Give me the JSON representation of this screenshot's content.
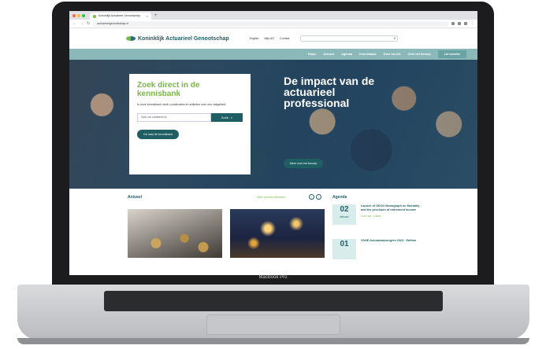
{
  "device": {
    "brand_label": "MacBook Pro"
  },
  "browser": {
    "tab_title": "Koninklijk Actuarieel Genootschap",
    "tab_close": "×",
    "new_tab": "+",
    "url": "actuarieelgenootschap.nl",
    "traffic_lights": [
      "#ff5f57",
      "#febc2e",
      "#28c840"
    ]
  },
  "site": {
    "logo_text": "Koninklijk Actuarieel Genootschap",
    "top_links": [
      "English",
      "Mijn AG",
      "Contact"
    ],
    "search_icon": "search-icon",
    "nav": [
      "Home",
      "Actueel",
      "Agenda",
      "Kennisbank",
      "Over het AG",
      "Over het beroep"
    ],
    "nav_cta": "Lid worden",
    "colors": {
      "primary": "#1f5f63",
      "accent": "#7ab648",
      "nav": "#8bb9b9"
    }
  },
  "hero": {
    "kb_title": "Zoek direct in de kennisbank",
    "kb_sub": "In onze kennisbank vindt u publicaties en artikelen over ons vakgebied.",
    "kb_placeholder": "Voer uw zoekterm in",
    "kb_button": "Zoek",
    "kb_link": "Ga naar de kennisbank",
    "title": "De impact van de actuarieel professional",
    "button": "Meer over het beroep"
  },
  "content": {
    "actueel_label": "Actueel",
    "more_label": "Meer actuele berichten",
    "agenda_label": "Agenda",
    "agenda": [
      {
        "day": "02",
        "month": "februari",
        "title": "Launch of OECD Monograph on Mortality and the provision of retirement income",
        "meta": "14:00 uur - Online"
      },
      {
        "day": "01",
        "month": "",
        "title": "VSAE Actuariaatcongres 2023 - Edition",
        "meta": ""
      }
    ]
  }
}
